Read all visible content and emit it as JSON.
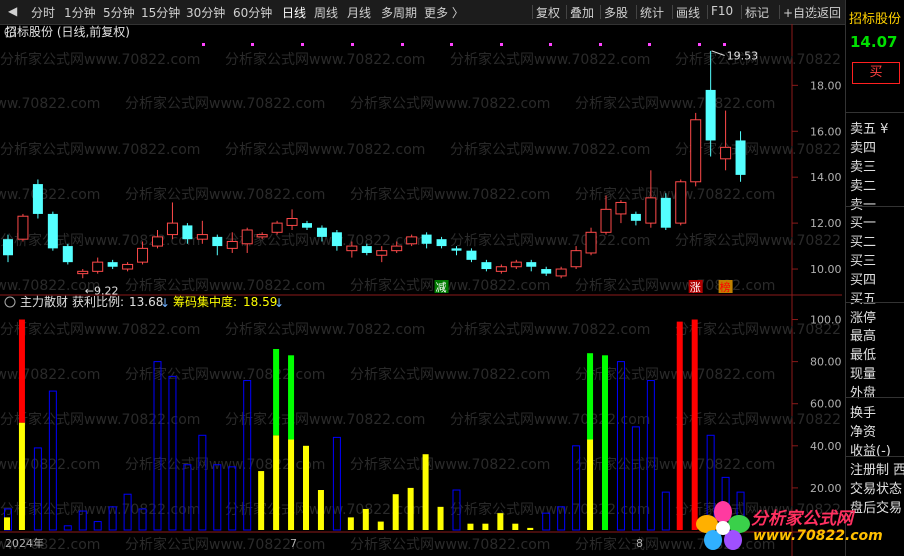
{
  "toolbar": {
    "periods": [
      "分时",
      "1分钟",
      "5分钟",
      "15分钟",
      "30分钟",
      "60分钟",
      "日线",
      "周线",
      "月线",
      "多周期",
      "更多 〉"
    ],
    "active_period": "日线",
    "tools": [
      "复权",
      "叠加",
      "多股",
      "统计",
      "画线",
      "F10",
      "标记",
      "+自选",
      "返回"
    ]
  },
  "stock": {
    "title": "招标股份 (日线,前复权)",
    "side_title": "招标股份",
    "price": "14.07",
    "buy_button": "买"
  },
  "price_panel": {
    "y_ticks": [
      "18.00",
      "16.00",
      "14.00",
      "12.00",
      "10.00"
    ],
    "high_label": "19.53",
    "low_label": "←9.22",
    "markers": [
      "减",
      "涨",
      "榜"
    ]
  },
  "indicator": {
    "name": "主力散财",
    "profit_label": "获利比例:",
    "profit_value": "13.68",
    "chip_label": "筹码集中度:",
    "chip_value": "18.59",
    "arrow": "↓",
    "y_ticks": [
      "100.0",
      "80.00",
      "60.00",
      "40.00",
      "20.00"
    ]
  },
  "x_axis": {
    "labels": [
      "2024年",
      "7",
      "8"
    ]
  },
  "watermark": "分析家公式网www.70822.com",
  "side_panel": {
    "rows": [
      "卖五 ¥",
      "卖四",
      "卖三",
      "卖二",
      "卖一",
      "买一",
      "买二",
      "买三",
      "买四",
      "买五",
      "涨停",
      "最高",
      "最低",
      "现量",
      "外盘",
      "换手",
      "净资",
      "收益(-)",
      "注册制 西",
      "交易状态",
      "盘后交易"
    ]
  },
  "logo": {
    "text": "分析家公式网",
    "url": "www.70822.com"
  },
  "colors": {
    "up": "#ff4a4a",
    "down": "#54ffff",
    "yellow": "#ffff00",
    "blue": "#0000ff",
    "green": "#00ff00",
    "red": "#ff0000",
    "active_tab": "#ffffff"
  },
  "chart_data": {
    "type": "candlestick",
    "price_range": [
      9.0,
      19.8
    ],
    "candles": [
      {
        "o": 10.6,
        "c": 11.3,
        "h": 11.5,
        "l": 10.3,
        "up": false
      },
      {
        "o": 11.3,
        "c": 12.3,
        "h": 12.4,
        "l": 11.2,
        "up": true
      },
      {
        "o": 13.7,
        "c": 12.4,
        "h": 13.9,
        "l": 12.2,
        "up": false
      },
      {
        "o": 12.4,
        "c": 10.9,
        "h": 12.5,
        "l": 10.8,
        "up": false
      },
      {
        "o": 11.0,
        "c": 10.3,
        "h": 11.1,
        "l": 10.2,
        "up": false
      },
      {
        "o": 9.8,
        "c": 9.9,
        "h": 10.0,
        "l": 9.6,
        "up": true
      },
      {
        "o": 9.9,
        "c": 10.3,
        "h": 10.5,
        "l": 9.8,
        "up": true
      },
      {
        "o": 10.3,
        "c": 10.1,
        "h": 10.4,
        "l": 10.0,
        "up": false
      },
      {
        "o": 10.0,
        "c": 10.2,
        "h": 10.3,
        "l": 9.9,
        "up": true
      },
      {
        "o": 10.3,
        "c": 10.9,
        "h": 11.2,
        "l": 10.2,
        "up": true
      },
      {
        "o": 11.0,
        "c": 11.4,
        "h": 11.7,
        "l": 10.9,
        "up": true
      },
      {
        "o": 11.5,
        "c": 12.0,
        "h": 12.9,
        "l": 11.3,
        "up": true
      },
      {
        "o": 11.9,
        "c": 11.3,
        "h": 12.0,
        "l": 11.1,
        "up": false
      },
      {
        "o": 11.3,
        "c": 11.5,
        "h": 12.1,
        "l": 11.1,
        "up": true
      },
      {
        "o": 11.4,
        "c": 11.0,
        "h": 11.5,
        "l": 10.6,
        "up": false
      },
      {
        "o": 10.9,
        "c": 11.2,
        "h": 11.6,
        "l": 10.7,
        "up": true
      },
      {
        "o": 11.1,
        "c": 11.7,
        "h": 11.8,
        "l": 10.7,
        "up": true
      },
      {
        "o": 11.4,
        "c": 11.5,
        "h": 11.6,
        "l": 11.3,
        "up": true
      },
      {
        "o": 11.6,
        "c": 12.0,
        "h": 12.1,
        "l": 11.5,
        "up": true
      },
      {
        "o": 11.9,
        "c": 12.2,
        "h": 12.6,
        "l": 11.7,
        "up": true
      },
      {
        "o": 12.0,
        "c": 11.8,
        "h": 12.1,
        "l": 11.7,
        "up": false
      },
      {
        "o": 11.8,
        "c": 11.4,
        "h": 11.9,
        "l": 11.2,
        "up": false
      },
      {
        "o": 11.6,
        "c": 11.0,
        "h": 11.7,
        "l": 10.8,
        "up": false
      },
      {
        "o": 10.8,
        "c": 11.0,
        "h": 11.2,
        "l": 10.5,
        "up": true
      },
      {
        "o": 11.0,
        "c": 10.7,
        "h": 11.1,
        "l": 10.6,
        "up": false
      },
      {
        "o": 10.6,
        "c": 10.8,
        "h": 11.0,
        "l": 10.3,
        "up": true
      },
      {
        "o": 10.8,
        "c": 11.0,
        "h": 11.2,
        "l": 10.7,
        "up": true
      },
      {
        "o": 11.1,
        "c": 11.4,
        "h": 11.5,
        "l": 11.0,
        "up": true
      },
      {
        "o": 11.5,
        "c": 11.1,
        "h": 11.6,
        "l": 10.9,
        "up": false
      },
      {
        "o": 11.3,
        "c": 11.0,
        "h": 11.4,
        "l": 10.9,
        "up": false
      },
      {
        "o": 10.9,
        "c": 10.8,
        "h": 11.0,
        "l": 10.6,
        "up": false
      },
      {
        "o": 10.8,
        "c": 10.4,
        "h": 10.9,
        "l": 10.3,
        "up": false
      },
      {
        "o": 10.3,
        "c": 10.0,
        "h": 10.4,
        "l": 9.9,
        "up": false
      },
      {
        "o": 9.9,
        "c": 10.1,
        "h": 10.2,
        "l": 9.8,
        "up": true
      },
      {
        "o": 10.1,
        "c": 10.3,
        "h": 10.4,
        "l": 10.0,
        "up": true
      },
      {
        "o": 10.3,
        "c": 10.1,
        "h": 10.4,
        "l": 9.9,
        "up": false
      },
      {
        "o": 10.0,
        "c": 9.8,
        "h": 10.1,
        "l": 9.7,
        "up": false
      },
      {
        "o": 9.7,
        "c": 10.0,
        "h": 10.1,
        "l": 9.6,
        "up": true
      },
      {
        "o": 10.1,
        "c": 10.8,
        "h": 11.0,
        "l": 10.0,
        "up": true
      },
      {
        "o": 10.7,
        "c": 11.6,
        "h": 11.8,
        "l": 10.6,
        "up": true
      },
      {
        "o": 11.6,
        "c": 12.6,
        "h": 13.2,
        "l": 11.5,
        "up": true
      },
      {
        "o": 12.4,
        "c": 12.9,
        "h": 13.0,
        "l": 12.0,
        "up": true
      },
      {
        "o": 12.1,
        "c": 12.4,
        "h": 12.5,
        "l": 11.9,
        "up": false
      },
      {
        "o": 12.0,
        "c": 13.1,
        "h": 14.3,
        "l": 11.8,
        "up": true
      },
      {
        "o": 13.1,
        "c": 11.8,
        "h": 13.3,
        "l": 11.7,
        "up": false
      },
      {
        "o": 12.0,
        "c": 13.8,
        "h": 13.9,
        "l": 11.9,
        "up": true
      },
      {
        "o": 13.8,
        "c": 16.5,
        "h": 16.8,
        "l": 13.6,
        "up": true
      },
      {
        "o": 17.8,
        "c": 15.6,
        "h": 19.5,
        "l": 14.9,
        "up": false
      },
      {
        "o": 14.8,
        "c": 15.3,
        "h": 16.9,
        "l": 14.3,
        "up": true
      },
      {
        "o": 15.6,
        "c": 14.1,
        "h": 16.0,
        "l": 13.8,
        "up": false
      }
    ],
    "indicator_range": [
      0,
      105
    ],
    "bars": [
      {
        "o": 10,
        "y": 6,
        "g": 0,
        "r": 0
      },
      {
        "o": 0,
        "y": 51,
        "g": 0,
        "r": 49
      },
      {
        "o": 39,
        "y": 0,
        "g": 0,
        "r": 0
      },
      {
        "o": 66,
        "y": 0,
        "g": 0,
        "r": 0
      },
      {
        "o": 2,
        "y": 0,
        "g": 0,
        "r": 0
      },
      {
        "o": 9,
        "y": 0,
        "g": 0,
        "r": 0
      },
      {
        "o": 4,
        "y": 0,
        "g": 0,
        "r": 0
      },
      {
        "o": 11,
        "y": 0,
        "g": 0,
        "r": 0
      },
      {
        "o": 17,
        "y": 0,
        "g": 0,
        "r": 0
      },
      {
        "o": 10,
        "y": 0,
        "g": 0,
        "r": 0
      },
      {
        "o": 80,
        "y": 0,
        "g": 0,
        "r": 0
      },
      {
        "o": 73,
        "y": 0,
        "g": 0,
        "r": 0
      },
      {
        "o": 31,
        "y": 0,
        "g": 0,
        "r": 0
      },
      {
        "o": 45,
        "y": 0,
        "g": 0,
        "r": 0
      },
      {
        "o": 31,
        "y": 0,
        "g": 0,
        "r": 0
      },
      {
        "o": 30,
        "y": 0,
        "g": 0,
        "r": 0
      },
      {
        "o": 71,
        "y": 0,
        "g": 0,
        "r": 0
      },
      {
        "o": 0,
        "y": 28,
        "g": 0,
        "r": 0
      },
      {
        "o": 0,
        "y": 45,
        "g": 41,
        "r": 0
      },
      {
        "o": 0,
        "y": 43,
        "g": 40,
        "r": 0
      },
      {
        "o": 0,
        "y": 40,
        "g": 0,
        "r": 0
      },
      {
        "o": 0,
        "y": 19,
        "g": 0,
        "r": 0
      },
      {
        "o": 44,
        "y": 0,
        "g": 0,
        "r": 0
      },
      {
        "o": 0,
        "y": 6,
        "g": 0,
        "r": 0
      },
      {
        "o": 0,
        "y": 10,
        "g": 0,
        "r": 0
      },
      {
        "o": 0,
        "y": 4,
        "g": 0,
        "r": 0
      },
      {
        "o": 0,
        "y": 17,
        "g": 0,
        "r": 0
      },
      {
        "o": 0,
        "y": 20,
        "g": 0,
        "r": 0
      },
      {
        "o": 0,
        "y": 36,
        "g": 0,
        "r": 0
      },
      {
        "o": 0,
        "y": 11,
        "g": 0,
        "r": 0
      },
      {
        "o": 19,
        "y": 0,
        "g": 0,
        "r": 0
      },
      {
        "o": 0,
        "y": 3,
        "g": 0,
        "r": 0
      },
      {
        "o": 0,
        "y": 3,
        "g": 0,
        "r": 0
      },
      {
        "o": 0,
        "y": 8,
        "g": 0,
        "r": 0
      },
      {
        "o": 0,
        "y": 3,
        "g": 0,
        "r": 0
      },
      {
        "o": 0,
        "y": 1,
        "g": 0,
        "r": 0
      },
      {
        "o": 8,
        "y": 0,
        "g": 0,
        "r": 0
      },
      {
        "o": 11,
        "y": 0,
        "g": 0,
        "r": 0
      },
      {
        "o": 40,
        "y": 0,
        "g": 0,
        "r": 0
      },
      {
        "o": 0,
        "y": 43,
        "g": 41,
        "r": 0
      },
      {
        "o": 0,
        "y": 0,
        "g": 83,
        "r": 0
      },
      {
        "o": 80,
        "y": 0,
        "g": 0,
        "r": 0
      },
      {
        "o": 49,
        "y": 0,
        "g": 0,
        "r": 0
      },
      {
        "o": 71,
        "y": 0,
        "g": 0,
        "r": 0
      },
      {
        "o": 18,
        "y": 0,
        "g": 0,
        "r": 0
      },
      {
        "o": 0,
        "y": 0,
        "g": 0,
        "r": 99
      },
      {
        "o": 0,
        "y": 0,
        "g": 0,
        "r": 100
      },
      {
        "o": 45,
        "y": 0,
        "g": 0,
        "r": 0
      },
      {
        "o": 25,
        "y": 0,
        "g": 0,
        "r": 0
      },
      {
        "o": 18,
        "y": 0,
        "g": 0,
        "r": 0
      }
    ]
  }
}
